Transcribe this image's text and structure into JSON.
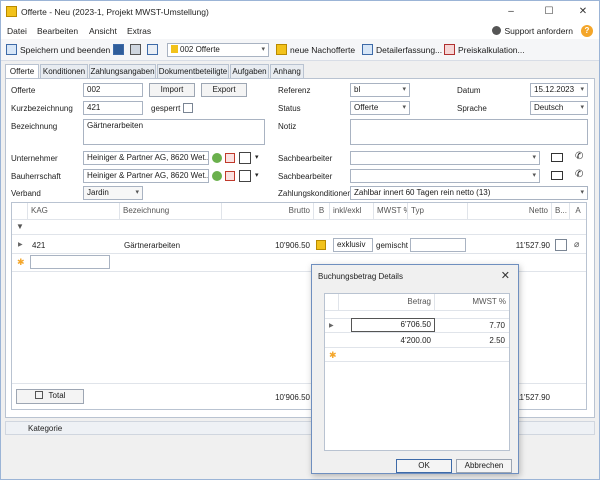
{
  "window": {
    "title": "Offerte - Neu (2023-1, Projekt MWST-Umstellung)",
    "controls": [
      "–",
      "☐",
      "✕"
    ]
  },
  "menu": {
    "items": [
      "Datei",
      "Bearbeiten",
      "Ansicht",
      "Extras"
    ],
    "support": "Support anfordern",
    "help": "?"
  },
  "toolbar": {
    "save_close": "Speichern und beenden",
    "doc_combo": "002 Offerte",
    "new_followup": "neue Nachofferte",
    "detail_entry": "Detailerfassung...",
    "price_calc": "Preiskalkulation..."
  },
  "tabs": [
    "Offerte",
    "Konditionen",
    "Zahlungsangaben",
    "Dokumentbeteiligte",
    "Aufgaben",
    "Anhang"
  ],
  "form": {
    "offerte_label": "Offerte",
    "offerte_value": "002",
    "import_btn": "Import",
    "export_btn": "Export",
    "kurz_label": "Kurzbezeichnung",
    "kurz_value": "421",
    "gesperrt_label": "gesperrt",
    "bezeichnung_label": "Bezeichnung",
    "bezeichnung_value": "Gärtnerarbeiten",
    "unternehmer_label": "Unternehmer",
    "unternehmer_value": "Heiniger & Partner AG, 8620 Wet...",
    "bauherr_label": "Bauherrschaft",
    "bauherr_value": "Heiniger & Partner AG, 8620 Wet...",
    "verband_label": "Verband",
    "verband_value": "Jardin",
    "referenz_label": "Referenz",
    "referenz_value": "bl",
    "status_label": "Status",
    "status_value": "Offerte",
    "notiz_label": "Notiz",
    "datum_label": "Datum",
    "datum_value": "15.12.2023",
    "sprache_label": "Sprache",
    "sprache_value": "Deutsch",
    "sb1_label": "Sachbearbeiter",
    "sb2_label": "Sachbearbeiter",
    "zk_label": "Zahlungskonditionen",
    "zk_value": "Zahlbar innert 60 Tagen rein netto (13)"
  },
  "grid": {
    "headers": [
      "KAG",
      "Bezeichnung",
      "Brutto",
      "B",
      "inkl/exkl",
      "MWST %",
      "Typ",
      "Netto",
      "B...",
      "A"
    ],
    "row": {
      "kag": "421",
      "bezeichnung": "Gärtnerarbeiten",
      "brutto": "10'906.50",
      "inkl": "exklusiv",
      "mwst": "gemischt",
      "netto": "11'527.90"
    },
    "total_label": "Total",
    "total_brutto": "10'906.50",
    "total_netto": "11'527.90"
  },
  "statusbar": {
    "kategorie": "Kategorie"
  },
  "dialog": {
    "title": "Buchungsbetrag Details",
    "headers": [
      "Betrag",
      "MWST %"
    ],
    "rows": [
      {
        "betrag": "6'706.50",
        "mwst": "7.70"
      },
      {
        "betrag": "4'200.00",
        "mwst": "2.50"
      }
    ],
    "ok": "OK",
    "cancel": "Abbrechen"
  },
  "colors": {
    "accent": "#3d6aa8",
    "new_row_marker": "#f4a62a",
    "border": "#b9c3d1"
  }
}
